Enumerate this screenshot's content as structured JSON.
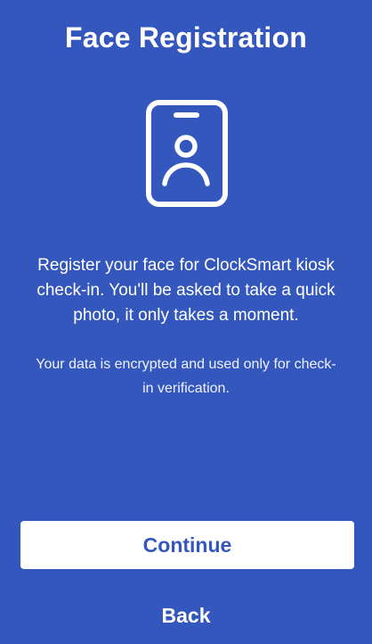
{
  "page": {
    "title": "Face Registration",
    "description": "Register your face for ClockSmart kiosk check-in. You'll be asked to take a quick photo, it only takes a moment.",
    "note": "Your data is encrypted and used only for check-in verification."
  },
  "icon": {
    "name": "id-badge-icon"
  },
  "actions": {
    "continue_label": "Continue",
    "back_label": "Back"
  },
  "colors": {
    "background": "#3457bd",
    "button_background": "#ffffff",
    "button_text": "#3457bd",
    "text": "#ffffff"
  }
}
